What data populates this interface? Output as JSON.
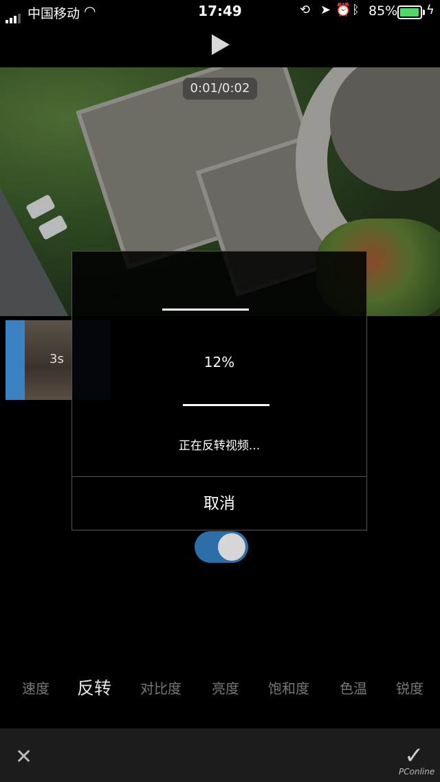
{
  "status": {
    "carrier": "中国移动",
    "time": "17:49",
    "battery": "85%"
  },
  "player": {
    "timecode": "0:01/0:02"
  },
  "timeline": {
    "clip_duration": "3s"
  },
  "dialog": {
    "progress": "12%",
    "message": "正在反转视频...",
    "cancel_label": "取消"
  },
  "tabs": [
    {
      "label": "速度"
    },
    {
      "label": "反转",
      "active": true
    },
    {
      "label": "对比度"
    },
    {
      "label": "亮度"
    },
    {
      "label": "饱和度"
    },
    {
      "label": "色温"
    },
    {
      "label": "锐度"
    }
  ],
  "toggle": {
    "on": true
  },
  "bottom": {
    "close": "✕",
    "confirm": "✓",
    "watermark": "PConline"
  },
  "colors": {
    "accent": "#3b82c3",
    "battery": "#4cd964"
  }
}
